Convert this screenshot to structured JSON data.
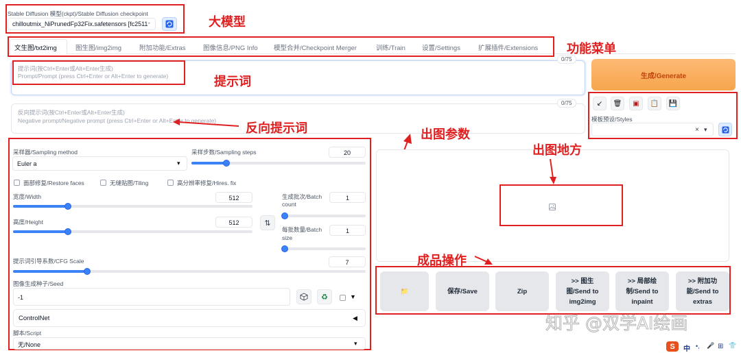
{
  "checkpoint": {
    "label": "Stable Diffusion 模型(ckpt)/Stable Diffusion checkpoint",
    "value": "chilloutmix_NiPrunedFp32Fix.safetensors [fc2511",
    "refresh_icon": "refresh-icon"
  },
  "tabs": [
    {
      "label": "文生图/txt2img",
      "active": true
    },
    {
      "label": "图生图/img2img"
    },
    {
      "label": "附加功能/Extras"
    },
    {
      "label": "图像信息/PNG Info"
    },
    {
      "label": "模型合并/Checkpoint Merger"
    },
    {
      "label": "训练/Train"
    },
    {
      "label": "设置/Settings"
    },
    {
      "label": "扩展插件/Extensions"
    }
  ],
  "prompt": {
    "counter": "0/75",
    "placeholder_line1": "提示词(按Ctrl+Enter或Alt+Enter生成)",
    "placeholder_line2": "Prompt/Prompt (press Ctrl+Enter or Alt+Enter to generate)"
  },
  "negative_prompt": {
    "counter": "0/75",
    "placeholder_line1": "反向提示词(按Ctrl+Enter或Alt+Enter生成)",
    "placeholder_line2": "Negative prompt/Negative prompt (press Ctrl+Enter or Alt+Enter to generate)"
  },
  "generate": {
    "label": "生成/Generate",
    "color": "#f59e0b"
  },
  "styles": {
    "label": "模板预设/Styles",
    "clear": "×",
    "dropdown": "▾",
    "tool_icons": [
      "arrow-icon",
      "trash-icon",
      "card-icon",
      "clipboard-icon",
      "save-icon"
    ],
    "tool_glyphs": [
      "↙",
      "🗑",
      "▣",
      "📋",
      "💾"
    ]
  },
  "params": {
    "sampling_method": {
      "label": "采样器/Sampling method",
      "value": "Euler a",
      "dropdown": "▾"
    },
    "sampling_steps": {
      "label": "采样步数/Sampling steps",
      "value": "20",
      "fraction": 0.2
    },
    "restore_faces": {
      "label": "面部修复/Restore faces",
      "checked": false
    },
    "tiling": {
      "label": "无缝贴图/Tiling",
      "checked": false
    },
    "hires_fix": {
      "label": "高分辨率修复/Hires. fix",
      "checked": false
    },
    "width": {
      "label": "宽度/Width",
      "value": "512",
      "fraction": 0.23
    },
    "height": {
      "label": "高度/Height",
      "value": "512",
      "fraction": 0.23
    },
    "swap_glyph": "⇅",
    "batch_count": {
      "label_line1": "生成批次/Batch",
      "label_line2": "count",
      "value": "1",
      "fraction": 0.0
    },
    "batch_size": {
      "label_line1": "每批数量/Batch",
      "label_line2": "size",
      "value": "1",
      "fraction": 0.0
    },
    "cfg_scale": {
      "label": "提示词引导系数/CFG Scale",
      "value": "7",
      "fraction": 0.21
    },
    "seed": {
      "label": "图像生成种子/Seed",
      "value": "-1",
      "dice_icon": "dice-icon",
      "recycle_icon": "recycle-icon",
      "extra_toggle": "▼"
    },
    "controlnet": {
      "label": "ControlNet",
      "toggle": "◀"
    },
    "script": {
      "label": "脚本/Script",
      "value": "无/None",
      "dropdown": "▾"
    }
  },
  "output_actions": [
    {
      "label": "📁",
      "name": "open-folder-button"
    },
    {
      "label": "保存/Save",
      "name": "save-button"
    },
    {
      "label": "Zip",
      "name": "zip-button"
    },
    {
      "label": ">> 图生\n图/Send to\nimg2img",
      "name": "send-to-img2img-button"
    },
    {
      "label": ">> 局部绘\n制/Send to\ninpaint",
      "name": "send-to-inpaint-button"
    },
    {
      "label": ">> 附加功\n能/Send to\nextras",
      "name": "send-to-extras-button"
    }
  ],
  "annotations": {
    "model": "大模型",
    "menu": "功能菜单",
    "prompt": "提示词",
    "negative": "反向提示词",
    "params": "出图参数",
    "output_area": "出图地方",
    "actions": "成品操作"
  },
  "watermark": "知乎 @双学AI绘画",
  "taskbar": {
    "badge": "S",
    "items": [
      "中",
      "•,",
      "🎤",
      "⊞",
      "👕"
    ]
  },
  "colors": {
    "accent": "#3b82f6",
    "annotation": "#e02020",
    "generate": "#f59e0b"
  }
}
